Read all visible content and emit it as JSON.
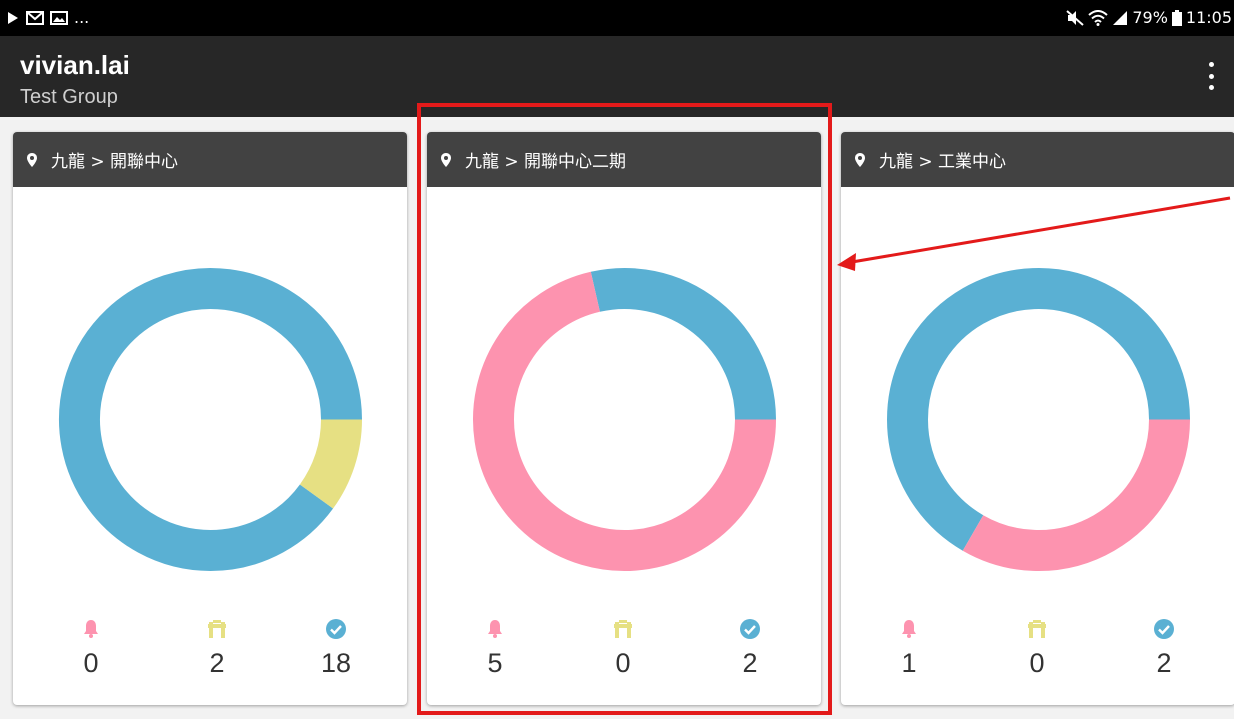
{
  "status_bar": {
    "left_icons": [
      "play-icon",
      "mail-icon",
      "image-icon"
    ],
    "ellipsis": "...",
    "right_icons": [
      "mute-icon",
      "wifi-icon",
      "signal-icon"
    ],
    "battery": "79%",
    "time": "11:05"
  },
  "appbar": {
    "title": "vivian.lai",
    "subtitle": "Test Group"
  },
  "colors": {
    "blue": "#5ab0d3",
    "pink": "#fd93af",
    "yellow": "#e6e083",
    "highlight": "#e31a1a"
  },
  "cards": [
    {
      "location": "九龍 > 開聯中心",
      "stats": {
        "alarm": "0",
        "warning": "2",
        "normal": "18"
      },
      "segments": [
        {
          "key": "blue",
          "value": 18
        },
        {
          "key": "yellow",
          "value": 2
        },
        {
          "key": "pink",
          "value": 0
        }
      ]
    },
    {
      "location": "九龍 > 開聯中心二期",
      "stats": {
        "alarm": "5",
        "warning": "0",
        "normal": "2"
      },
      "segments": [
        {
          "key": "blue",
          "value": 2
        },
        {
          "key": "pink",
          "value": 5
        },
        {
          "key": "yellow",
          "value": 0
        }
      ]
    },
    {
      "location": "九龍 > 工業中心",
      "stats": {
        "alarm": "1",
        "warning": "0",
        "normal": "2"
      },
      "segments": [
        {
          "key": "blue",
          "value": 2
        },
        {
          "key": "pink",
          "value": 1
        },
        {
          "key": "yellow",
          "value": 0
        }
      ]
    }
  ]
}
